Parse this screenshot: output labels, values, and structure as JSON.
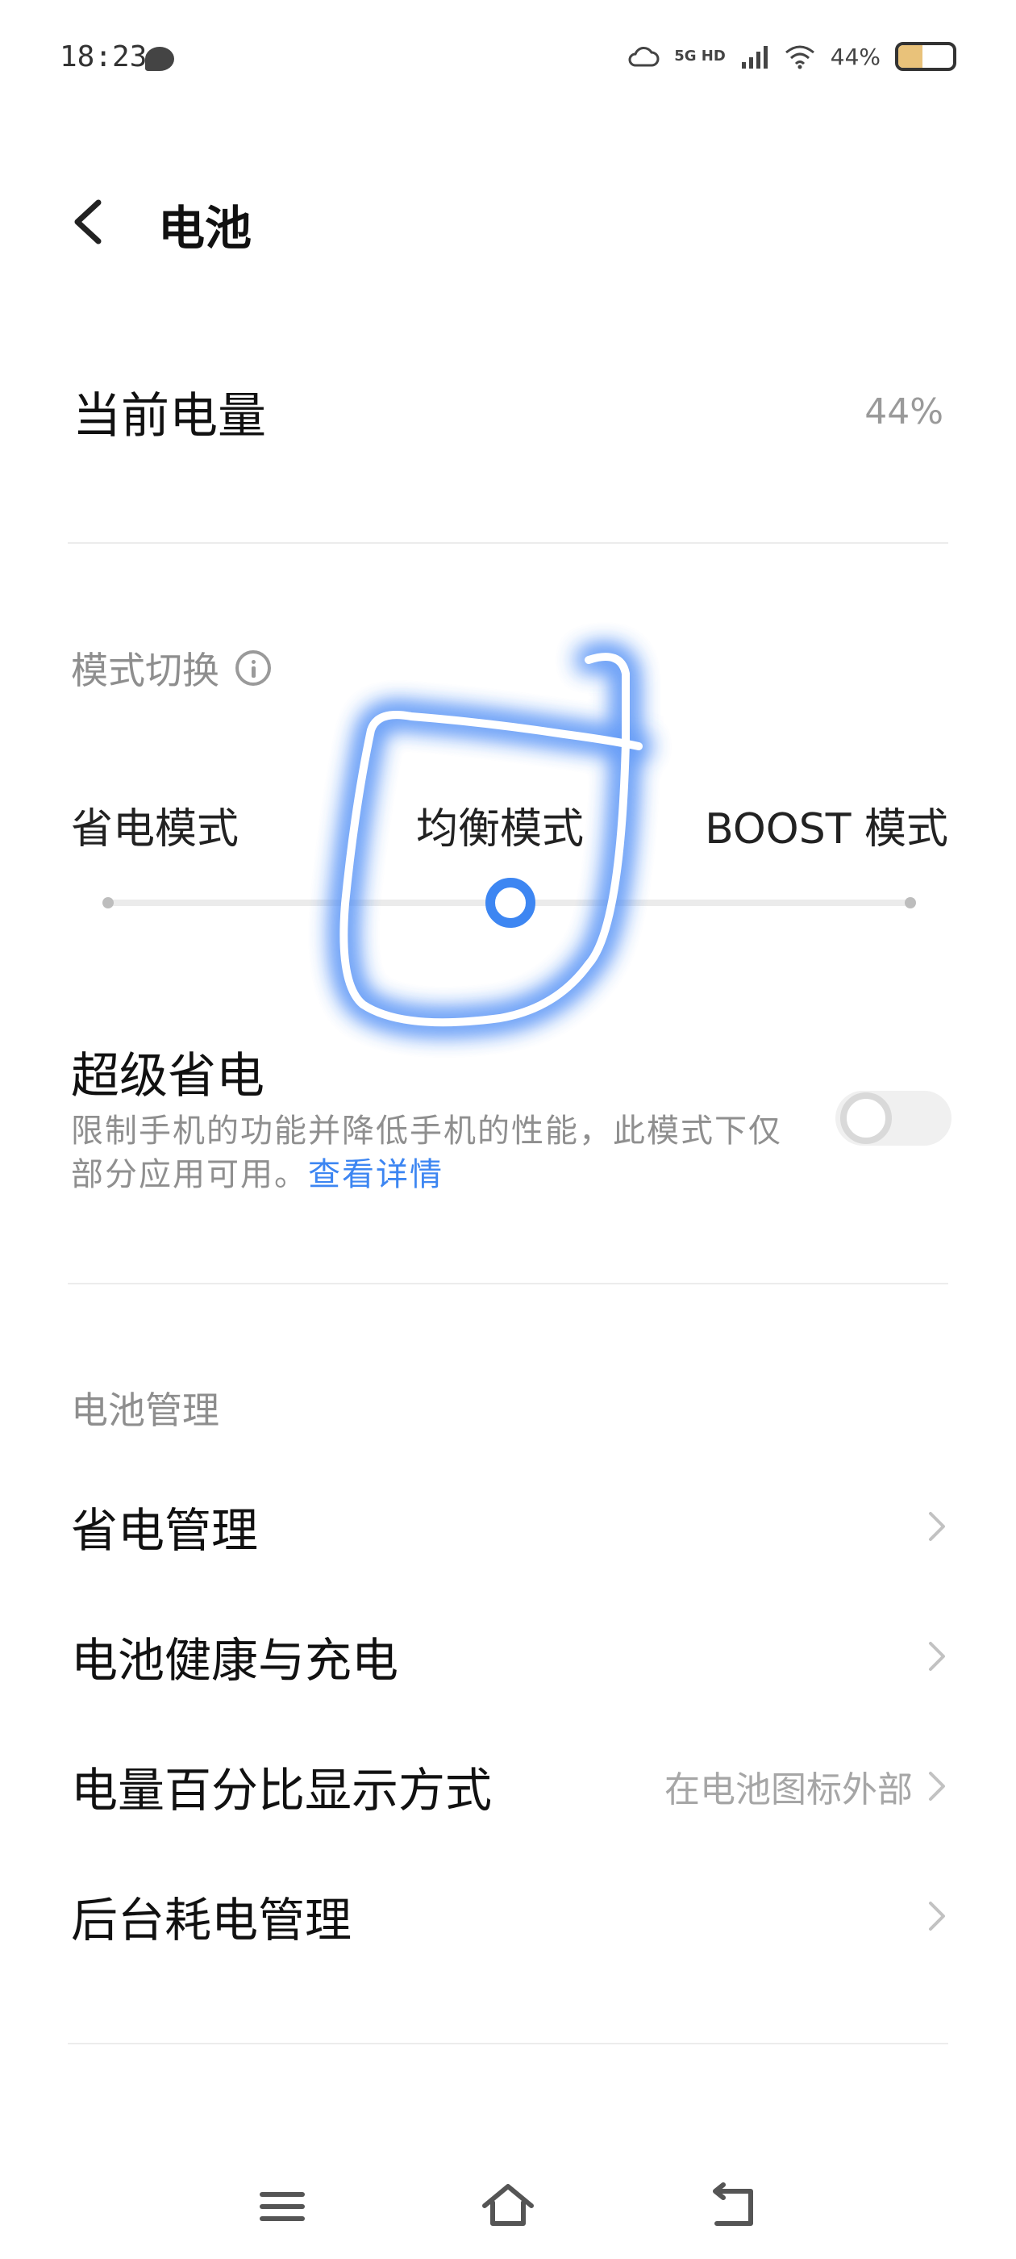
{
  "status_bar": {
    "time": "18:23",
    "network": "5G HD",
    "battery_percent": "44%",
    "battery_level": 0.44,
    "icons": [
      "chat-bubble-icon",
      "cloud-icon",
      "signal-icon",
      "wifi-icon",
      "battery-icon"
    ]
  },
  "header": {
    "title": "电池"
  },
  "current": {
    "label": "当前电量",
    "value": "44%"
  },
  "mode_switch": {
    "title": "模式切换",
    "modes": [
      "省电模式",
      "均衡模式",
      "BOOST 模式"
    ],
    "selected_index": 1,
    "accent_color": "#3d86f2"
  },
  "super_saver": {
    "title": "超级省电",
    "desc": "限制手机的功能并降低手机的性能，此模式下仅部分应用可用。",
    "link": "查看详情",
    "enabled": false
  },
  "battery_management": {
    "title": "电池管理",
    "items": [
      {
        "label": "省电管理",
        "value": ""
      },
      {
        "label": "电池健康与充电",
        "value": ""
      },
      {
        "label": "电量百分比显示方式",
        "value": "在电池图标外部"
      },
      {
        "label": "后台耗电管理",
        "value": ""
      }
    ]
  },
  "navbar": {
    "icons": [
      "menu-icon",
      "home-icon",
      "back-nav-icon"
    ]
  }
}
